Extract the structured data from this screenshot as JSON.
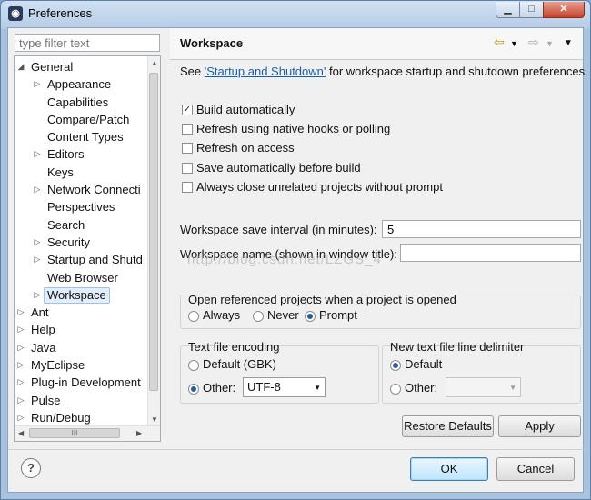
{
  "window": {
    "title": "Preferences",
    "minimize": "▁",
    "maximize": "□",
    "close": "✕",
    "icon": "eclipse-icon"
  },
  "filter": {
    "placeholder": "type filter text"
  },
  "tree": {
    "items": [
      {
        "label": "General",
        "expanded": true,
        "level": 0
      },
      {
        "label": "Appearance",
        "expandable": true,
        "level": 1
      },
      {
        "label": "Capabilities",
        "level": 1
      },
      {
        "label": "Compare/Patch",
        "level": 1
      },
      {
        "label": "Content Types",
        "level": 1
      },
      {
        "label": "Editors",
        "expandable": true,
        "level": 1
      },
      {
        "label": "Keys",
        "level": 1
      },
      {
        "label": "Network Connecti",
        "expandable": true,
        "level": 1
      },
      {
        "label": "Perspectives",
        "level": 1
      },
      {
        "label": "Search",
        "level": 1
      },
      {
        "label": "Security",
        "expandable": true,
        "level": 1
      },
      {
        "label": "Startup and Shutd",
        "expandable": true,
        "level": 1
      },
      {
        "label": "Web Browser",
        "level": 1
      },
      {
        "label": "Workspace",
        "expandable": true,
        "level": 1,
        "selected": true
      },
      {
        "label": "Ant",
        "expandable": true,
        "level": 0
      },
      {
        "label": "Help",
        "expandable": true,
        "level": 0
      },
      {
        "label": "Java",
        "expandable": true,
        "level": 0
      },
      {
        "label": "MyEclipse",
        "expandable": true,
        "level": 0
      },
      {
        "label": "Plug-in Development",
        "expandable": true,
        "level": 0
      },
      {
        "label": "Pulse",
        "expandable": true,
        "level": 0
      },
      {
        "label": "Run/Debug",
        "expandable": true,
        "level": 0
      }
    ],
    "hscroll_grip": "III"
  },
  "page": {
    "title": "Workspace",
    "see_prefix": "See ",
    "see_link": "'Startup and Shutdown'",
    "see_suffix": " for workspace startup and shutdown preferences.",
    "checkboxes": [
      {
        "label": "Build automatically",
        "checked": true
      },
      {
        "label": "Refresh using native hooks or polling",
        "checked": false
      },
      {
        "label": "Refresh on access",
        "checked": false
      },
      {
        "label": "Save automatically before build",
        "checked": false
      },
      {
        "label": "Always close unrelated projects without prompt",
        "checked": false
      }
    ],
    "save_interval_label": "Workspace save interval (in minutes):",
    "save_interval_value": "5",
    "name_label": "Workspace name (shown in window title):",
    "name_value": "",
    "open_projects": {
      "title": "Open referenced projects when a project is opened",
      "options": [
        "Always",
        "Never",
        "Prompt"
      ],
      "selected": "Prompt"
    },
    "encoding": {
      "title": "Text file encoding",
      "default_label": "Default (GBK)",
      "other_label": "Other:",
      "selected": "Other",
      "value": "UTF-8"
    },
    "delimiter": {
      "title": "New text file line delimiter",
      "default_label": "Default",
      "other_label": "Other:",
      "selected": "Default",
      "value": ""
    },
    "restore_defaults": "Restore Defaults",
    "apply": "Apply"
  },
  "footer": {
    "help": "?",
    "ok": "OK",
    "cancel": "Cancel"
  },
  "watermark": "http://blog.csdn.net/LZGS_4"
}
